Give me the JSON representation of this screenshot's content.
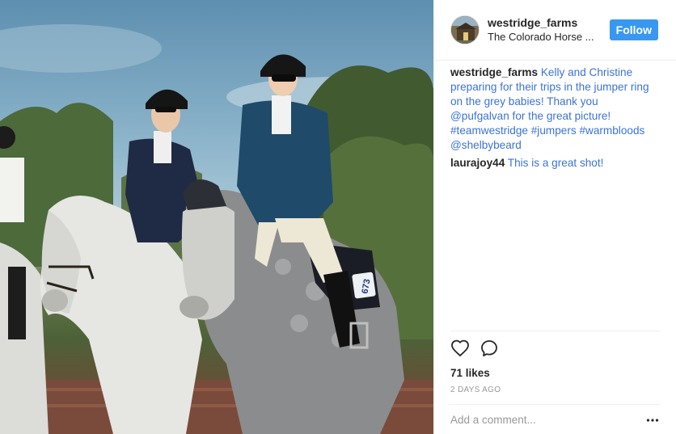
{
  "header": {
    "username": "westridge_farms",
    "location": "The Colorado Horse ...",
    "follow_label": "Follow",
    "avatar_icon": "avatar-icon"
  },
  "caption": {
    "username": "westridge_farms",
    "text": "Kelly and Christine preparing for their trips in the jumper ring on the grey babies! Thank you ",
    "mention1": "@pufgalvan",
    "text2": " for the great picture! ",
    "hashtag1": "#teamwestridge",
    "hashtag2": "#jumpers",
    "hashtag3": "#warmbloods",
    "mention2": "@shelbybeard"
  },
  "comments": [
    {
      "username": "laurajoy44",
      "text": "This is a great shot!"
    }
  ],
  "actions": {
    "like_icon": "heart-icon",
    "comment_icon": "speech-bubble-icon"
  },
  "likes": "71 likes",
  "timeago": "2 DAYS AGO",
  "comment_box": {
    "placeholder": "Add a comment...",
    "more_icon": "ellipsis-icon"
  },
  "photo": {
    "saddle_pad_number": "673"
  },
  "colors": {
    "link": "#3b73d9",
    "follow_button": "#3897f0",
    "divider": "#efefef",
    "muted": "#999999"
  }
}
